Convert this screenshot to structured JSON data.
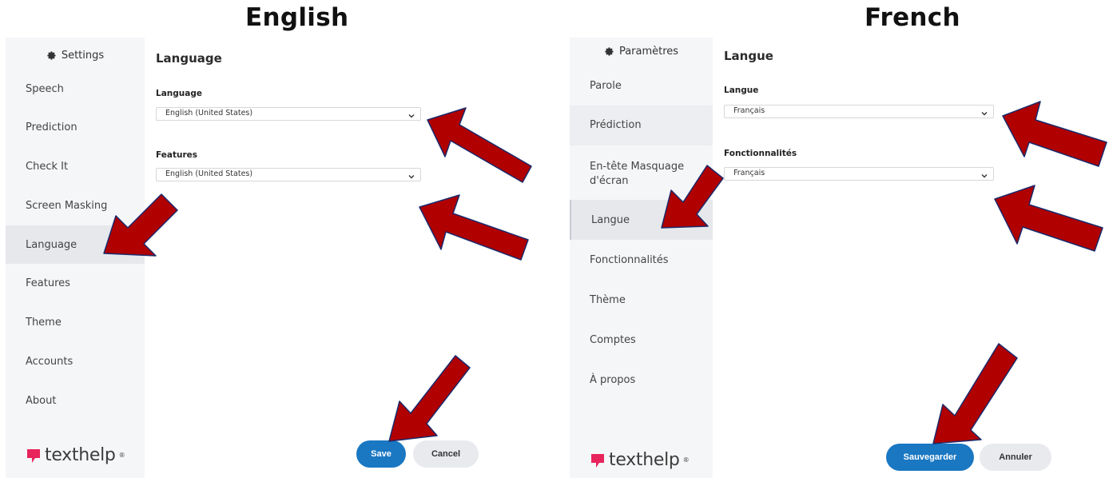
{
  "headings": {
    "left": "English",
    "right": "French"
  },
  "english": {
    "sidebar": {
      "header": "Settings",
      "items": [
        {
          "label": "Speech"
        },
        {
          "label": "Prediction"
        },
        {
          "label": "Check It"
        },
        {
          "label": "Screen Masking"
        },
        {
          "label": "Language",
          "active": true
        },
        {
          "label": "Features"
        },
        {
          "label": "Theme"
        },
        {
          "label": "Accounts"
        },
        {
          "label": "About"
        }
      ]
    },
    "main": {
      "title": "Language",
      "fields": [
        {
          "label": "Language",
          "value": "English (United States)"
        },
        {
          "label": "Features",
          "value": "English (United States)"
        }
      ]
    },
    "buttons": {
      "save": "Save",
      "cancel": "Cancel"
    }
  },
  "french": {
    "sidebar": {
      "header": "Paramètres",
      "items": [
        {
          "label": "Parole"
        },
        {
          "label": "Prédiction",
          "highlight": true
        },
        {
          "label": "En-tête Masquage d'écran"
        },
        {
          "label": "Langue",
          "active": true
        },
        {
          "label": "Fonctionnalités"
        },
        {
          "label": "Thème"
        },
        {
          "label": "Comptes"
        },
        {
          "label": "À propos"
        }
      ]
    },
    "main": {
      "title": "Langue",
      "fields": [
        {
          "label": "Langue",
          "value": "Français"
        },
        {
          "label": "Fonctionnalités",
          "value": "Français"
        }
      ]
    },
    "buttons": {
      "save": "Sauvegarder",
      "cancel": "Annuler"
    }
  },
  "logo": {
    "text": "texthelp",
    "mark": "®"
  },
  "colors": {
    "primary": "#1a77c2",
    "arrow_fill": "#b00000",
    "arrow_outline": "#1c2a6b",
    "logo_pink": "#e8245c"
  },
  "icons": [
    "gear-icon",
    "chevron-down-icon",
    "texthelp-logo",
    "annotation-arrow"
  ]
}
